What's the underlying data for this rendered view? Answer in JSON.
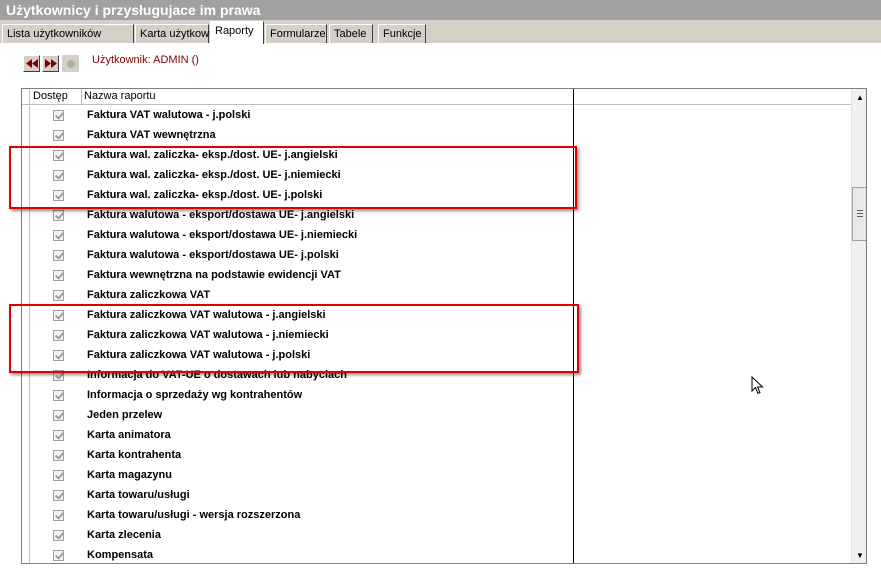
{
  "window": {
    "title": "Użytkownicy i przysługujace im prawa"
  },
  "tabs": [
    {
      "label": "Lista użytkowników",
      "active": false
    },
    {
      "label": "Karta użytkownika",
      "active": false
    },
    {
      "label": "Raporty",
      "active": true
    },
    {
      "label": "Formularze",
      "active": false
    },
    {
      "label": "Tabele",
      "active": false
    },
    {
      "label": "Funkcje",
      "active": false
    }
  ],
  "user_label": "Użytkownik: ADMIN  ()",
  "nav_icons": [
    "rewind-icon",
    "fast-forward-icon",
    "record-icon"
  ],
  "grid": {
    "columns": {
      "access": "Dostęp",
      "name": "Nazwa raportu"
    },
    "rows": [
      {
        "name": "Faktura VAT walutowa - j.polski",
        "checked": true
      },
      {
        "name": "Faktura VAT wewnętrzna",
        "checked": true
      },
      {
        "name": "Faktura wal. zaliczka- eksp./dost. UE- j.angielski",
        "checked": true
      },
      {
        "name": "Faktura wal. zaliczka- eksp./dost. UE- j.niemiecki",
        "checked": true
      },
      {
        "name": "Faktura wal. zaliczka- eksp./dost. UE- j.polski",
        "checked": true
      },
      {
        "name": "Faktura walutowa - eksport/dostawa UE- j.angielski",
        "checked": true
      },
      {
        "name": "Faktura walutowa - eksport/dostawa UE- j.niemiecki",
        "checked": true
      },
      {
        "name": "Faktura walutowa - eksport/dostawa UE- j.polski",
        "checked": true
      },
      {
        "name": "Faktura wewnętrzna na podstawie ewidencji VAT",
        "checked": true
      },
      {
        "name": "Faktura zaliczkowa VAT",
        "checked": true
      },
      {
        "name": "Faktura zaliczkowa VAT walutowa - j.angielski",
        "checked": true
      },
      {
        "name": "Faktura zaliczkowa VAT walutowa - j.niemiecki",
        "checked": true
      },
      {
        "name": "Faktura zaliczkowa VAT walutowa - j.polski",
        "checked": true
      },
      {
        "name": "Informacja do VAT-UE o dostawach lub nabyciach",
        "checked": true
      },
      {
        "name": "Informacja o sprzedaży wg kontrahentów",
        "checked": true
      },
      {
        "name": "Jeden przelew",
        "checked": true
      },
      {
        "name": "Karta animatora",
        "checked": true
      },
      {
        "name": "Karta kontrahenta",
        "checked": true
      },
      {
        "name": "Karta magazynu",
        "checked": true
      },
      {
        "name": "Karta towaru/usługi",
        "checked": true
      },
      {
        "name": "Karta towaru/usługi - wersja rozszerzona",
        "checked": true
      },
      {
        "name": "Karta zlecenia",
        "checked": true
      },
      {
        "name": "Kompensata",
        "checked": true
      }
    ]
  },
  "colors": {
    "highlight": "#e00000",
    "user_label": "#800000",
    "titlebar": "#a0a0a0"
  }
}
